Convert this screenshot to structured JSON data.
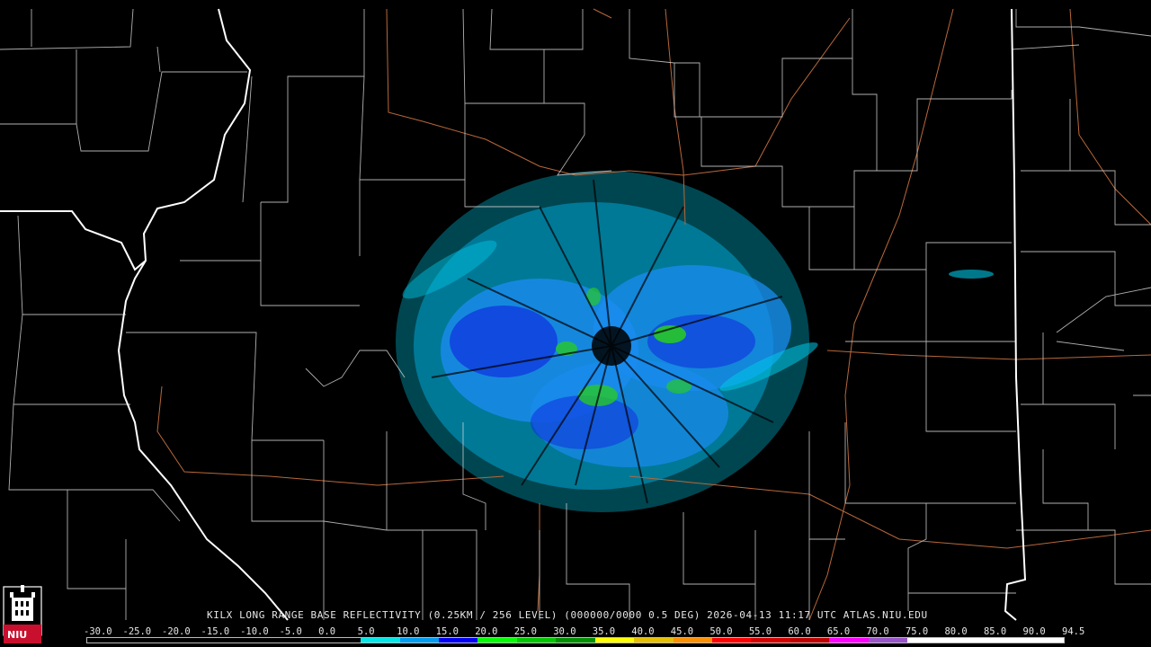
{
  "caption": "KILX LONG RANGE BASE REFLECTIVITY (0.25KM / 256 LEVEL) (000000/0000 0.5 DEG) 2026-04-13 11:17 UTC  ATLAS.NIU.EDU",
  "logo_text": "NIU",
  "scale_labels": [
    "-30.0",
    "-25.0",
    "-20.0",
    "-15.0",
    "-10.0",
    "-5.0",
    "0.0",
    "5.0",
    "10.0",
    "15.0",
    "20.0",
    "25.0",
    "30.0",
    "35.0",
    "40.0",
    "45.0",
    "50.0",
    "55.0",
    "60.0",
    "65.0",
    "70.0",
    "75.0",
    "80.0",
    "85.0",
    "90.0",
    "94.5"
  ],
  "scale_colors": [
    "#000000",
    "#000000",
    "#000000",
    "#000000",
    "#000000",
    "#000000",
    "#000000",
    "#00e8e8",
    "#009cf0",
    "#0000f6",
    "#00ff00",
    "#00c800",
    "#009000",
    "#ffff00",
    "#e7c000",
    "#ff9000",
    "#ff0000",
    "#d60000",
    "#c00000",
    "#ff00ff",
    "#9955c9",
    "#ffffff",
    "#ffffff",
    "#ffffff",
    "#ffffff"
  ],
  "colors": {
    "background": "#000000",
    "county_lines": "#cfcfcf",
    "state_lines": "#ffffff",
    "highways": "#b8683a",
    "echo_light": "#00c8e8",
    "echo_medium": "#1a8cf0",
    "echo_strong": "#1030e0",
    "echo_green": "#28c828"
  },
  "radar_site": "KILX"
}
